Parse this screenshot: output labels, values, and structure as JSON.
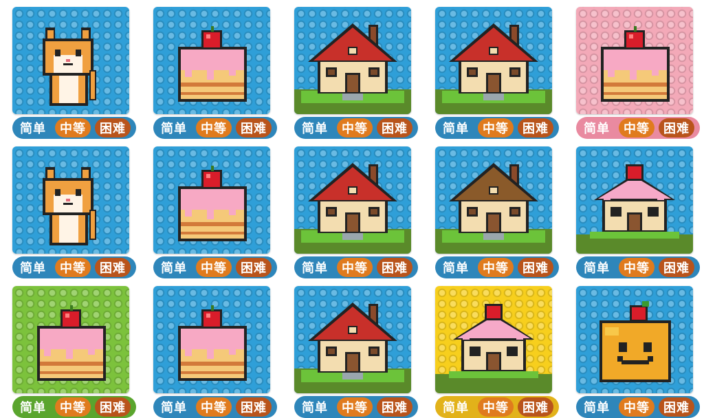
{
  "labels": {
    "easy": "简单",
    "medium": "中等",
    "hard": "困难"
  },
  "colors": {
    "blue": "#2f9fd8",
    "pink": "#f3a9b8",
    "green": "#7cc23c",
    "yellow": "#f7cf1d",
    "bar_blue": "#2e86ba",
    "bar_pink": "#e98aa0",
    "bar_green": "#5aa52e",
    "bar_yellow": "#e2b21a",
    "medium_chip": "#e07b1e",
    "hard_chip": "#b9541b"
  },
  "puzzles": [
    {
      "subject": "cat",
      "theme": "blue"
    },
    {
      "subject": "cake",
      "theme": "blue"
    },
    {
      "subject": "house",
      "theme": "blue"
    },
    {
      "subject": "house",
      "theme": "blue"
    },
    {
      "subject": "cake",
      "theme": "pink"
    },
    {
      "subject": "cat",
      "theme": "blue"
    },
    {
      "subject": "cake",
      "theme": "blue"
    },
    {
      "subject": "house",
      "theme": "blue"
    },
    {
      "subject": "house",
      "theme": "blue"
    },
    {
      "subject": "cake-house",
      "theme": "blue"
    },
    {
      "subject": "cake",
      "theme": "green"
    },
    {
      "subject": "cake",
      "theme": "blue"
    },
    {
      "subject": "house",
      "theme": "blue"
    },
    {
      "subject": "cake-house",
      "theme": "yellow"
    },
    {
      "subject": "smiley-cake",
      "theme": "blue"
    }
  ]
}
